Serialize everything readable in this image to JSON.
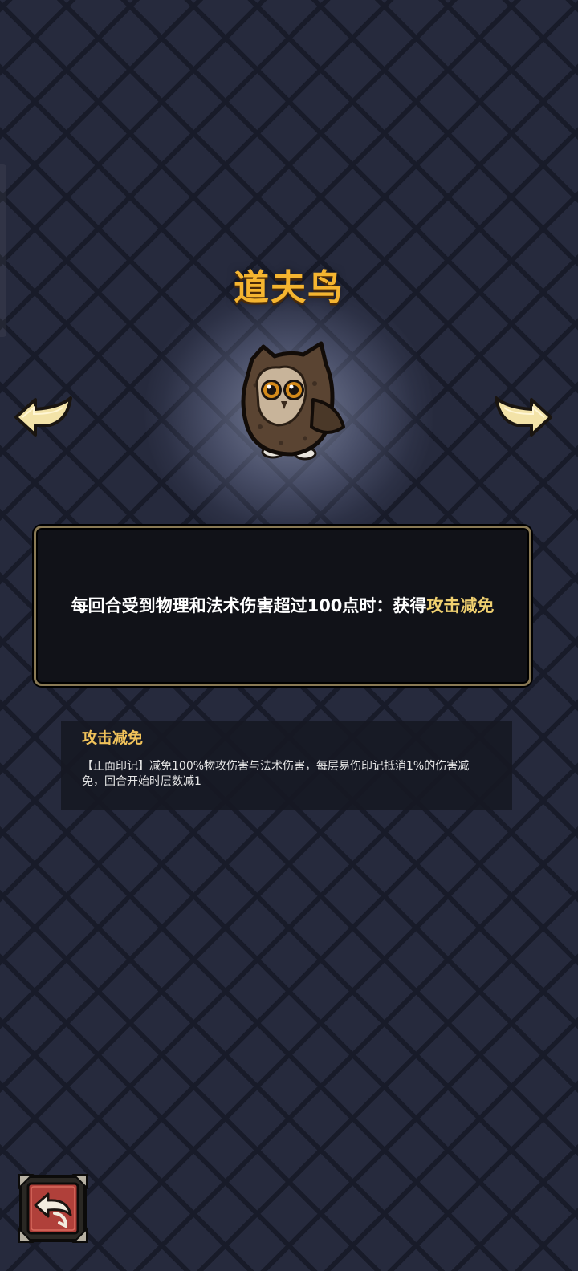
{
  "character": {
    "name": "道夫鸟"
  },
  "navigation": {
    "prev_icon": "left-arrow-icon",
    "next_icon": "right-arrow-icon"
  },
  "description": {
    "text_main": "每回合受到物理和法术伤害超过100点时：获得",
    "text_highlight": "攻击减免"
  },
  "keyword": {
    "title": "攻击减免",
    "text": "【正面印记】减免100%物攻伤害与法术伤害，每层易伤印记抵消1%的伤害减免，回合开始时层数减1"
  },
  "footer": {
    "back_icon": "return-arrow-icon"
  },
  "colors": {
    "title": "#f5b530",
    "highlight": "#f0d070",
    "keyword_title": "#f0c25a",
    "panel_border": "#8a7a55",
    "back_button": "#b0403a"
  }
}
